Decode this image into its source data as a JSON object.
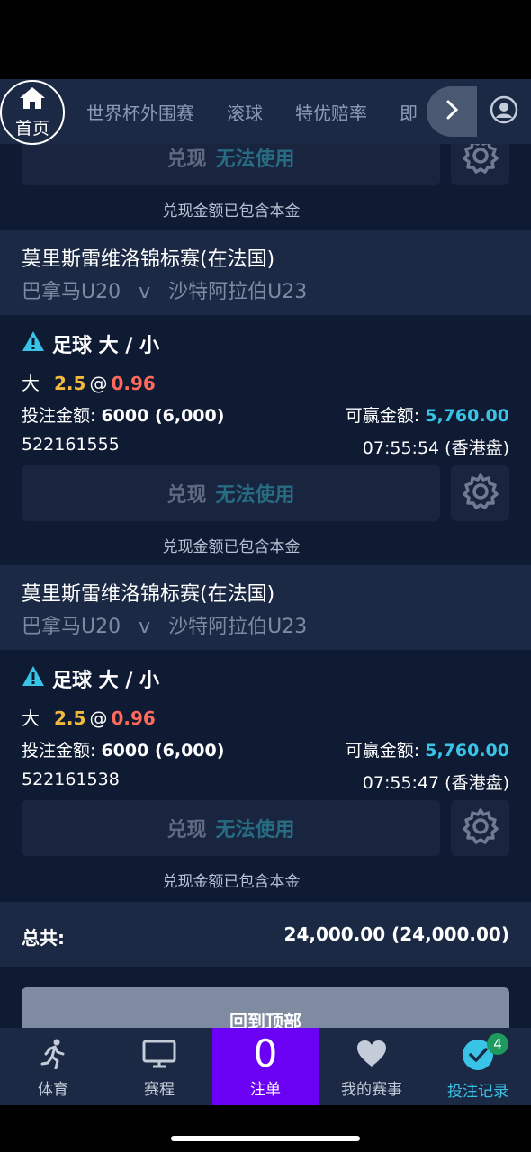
{
  "nav": {
    "home_label": "首页",
    "tabs": [
      "世界杯外围赛",
      "滚球",
      "特优赔率",
      "即"
    ]
  },
  "cashout": {
    "label": "兑现",
    "status": "无法使用",
    "note": "兑现金额已包含本金"
  },
  "bets": [
    {
      "league": "莫里斯雷维洛锦标赛(在法国)",
      "home": "巴拿马U20",
      "vs": "v",
      "away": "沙特阿拉伯U23",
      "market": "足球 大 / 小",
      "selection": "大",
      "handicap": "2.5",
      "at": "@",
      "odds": "0.96",
      "stake_label": "投注金额:",
      "stake": "6000 (6,000)",
      "win_label": "可赢金额:",
      "win": "5,760.00",
      "id": "522161555",
      "time": "07:55:54 (香港盘)"
    },
    {
      "league": "莫里斯雷维洛锦标赛(在法国)",
      "home": "巴拿马U20",
      "vs": "v",
      "away": "沙特阿拉伯U23",
      "market": "足球 大 / 小",
      "selection": "大",
      "handicap": "2.5",
      "at": "@",
      "odds": "0.96",
      "stake_label": "投注金额:",
      "stake": "6000 (6,000)",
      "win_label": "可赢金额:",
      "win": "5,760.00",
      "id": "522161538",
      "time": "07:55:47 (香港盘)"
    }
  ],
  "total": {
    "label": "总共:",
    "value": "24,000.00 (24,000.00)"
  },
  "back_to_top": "回到顶部",
  "tabbar": {
    "sports": "体育",
    "schedule": "赛程",
    "betslip_count": "0",
    "betslip": "注单",
    "my_events": "我的赛事",
    "bet_history": "投注记录",
    "bet_history_badge": "4"
  },
  "colors": {
    "background": "#0f1a33",
    "header": "#1b2944",
    "accent": "#39c3e6",
    "odds": "#ff6a5c",
    "handicap": "#f2b93b",
    "betslip": "#6a00f4"
  }
}
